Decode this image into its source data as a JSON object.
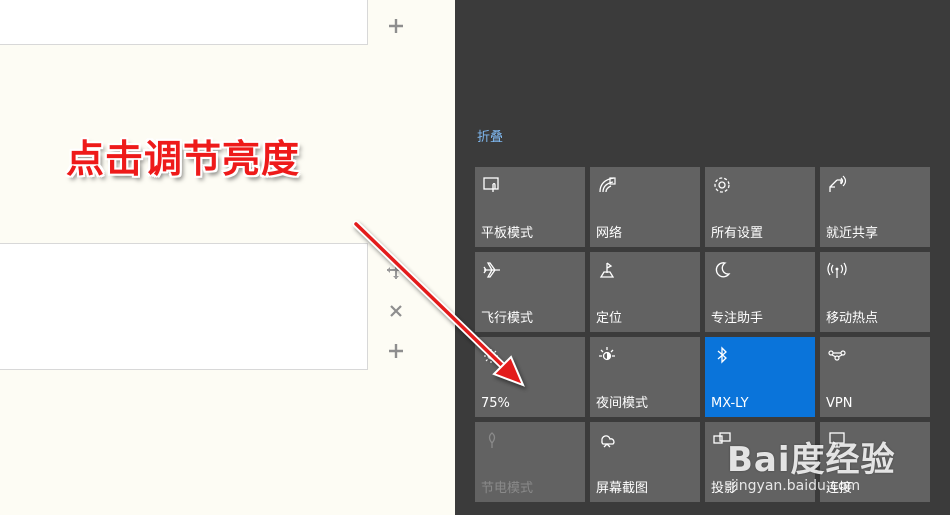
{
  "annotation": {
    "caption": "点击调节亮度",
    "arrow_color": "#e31b1b"
  },
  "action_center": {
    "collapse_label": "折叠",
    "accent_color": "#0a74da",
    "tiles": [
      {
        "label": "平板模式",
        "icon": "tablet-mode-icon",
        "state": "off"
      },
      {
        "label": "网络",
        "icon": "network-icon",
        "state": "off"
      },
      {
        "label": "所有设置",
        "icon": "settings-gear-icon",
        "state": "off"
      },
      {
        "label": "就近共享",
        "icon": "nearby-share-icon",
        "state": "off"
      },
      {
        "label": "飞行模式",
        "icon": "airplane-icon",
        "state": "off"
      },
      {
        "label": "定位",
        "icon": "location-icon",
        "state": "off"
      },
      {
        "label": "专注助手",
        "icon": "moon-icon",
        "state": "off"
      },
      {
        "label": "移动热点",
        "icon": "hotspot-icon",
        "state": "off"
      },
      {
        "label": "75%",
        "icon": "brightness-icon",
        "state": "off"
      },
      {
        "label": "夜间模式",
        "icon": "night-light-icon",
        "state": "off"
      },
      {
        "label": "MX-LY",
        "icon": "bluetooth-icon",
        "state": "on"
      },
      {
        "label": "VPN",
        "icon": "vpn-icon",
        "state": "off"
      },
      {
        "label": "节电模式",
        "icon": "battery-saver-icon",
        "state": "disabled"
      },
      {
        "label": "屏幕截图",
        "icon": "screen-snip-icon",
        "state": "off"
      },
      {
        "label": "投影",
        "icon": "project-icon",
        "state": "off"
      },
      {
        "label": "连接",
        "icon": "connect-icon",
        "state": "off"
      }
    ]
  },
  "editor": {
    "side_tools": [
      {
        "icon": "plus-icon"
      },
      {
        "icon": "move-icon"
      },
      {
        "icon": "close-icon"
      },
      {
        "icon": "plus-icon"
      }
    ]
  },
  "watermark": {
    "brand": "Bai度经验",
    "url": "jingyan.baidu.com"
  }
}
